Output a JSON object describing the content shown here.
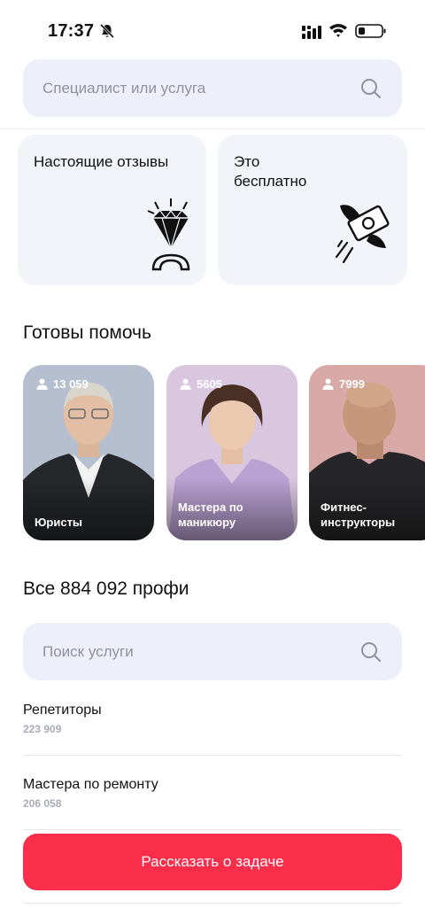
{
  "status": {
    "time": "17:37"
  },
  "search": {
    "placeholder": "Специалист или услуга"
  },
  "promos": [
    {
      "label": "Настоящие отзывы",
      "icon": "diamond-icon"
    },
    {
      "label": "Это бесплатно",
      "icon": "flying-money-icon"
    }
  ],
  "ready": {
    "title": "Готовы помочь",
    "cards": [
      {
        "count": "13 059",
        "name": "Юристы",
        "bg": "#b6bfcf"
      },
      {
        "count": "5605",
        "name": "Мастера по маникюру",
        "bg": "#d9c7e0"
      },
      {
        "count": "7999",
        "name": "Фитнес-инструкторы",
        "bg": "#d8a9a6"
      }
    ]
  },
  "all": {
    "title": "Все 884 092 профи",
    "search_placeholder": "Поиск услуги",
    "categories": [
      {
        "name": "Репетиторы",
        "count": "223 909"
      },
      {
        "name": "Мастера по ремонту",
        "count": "206 058"
      }
    ]
  },
  "cta": {
    "label": "Рассказать о задаче",
    "color": "#fa2d4b"
  }
}
